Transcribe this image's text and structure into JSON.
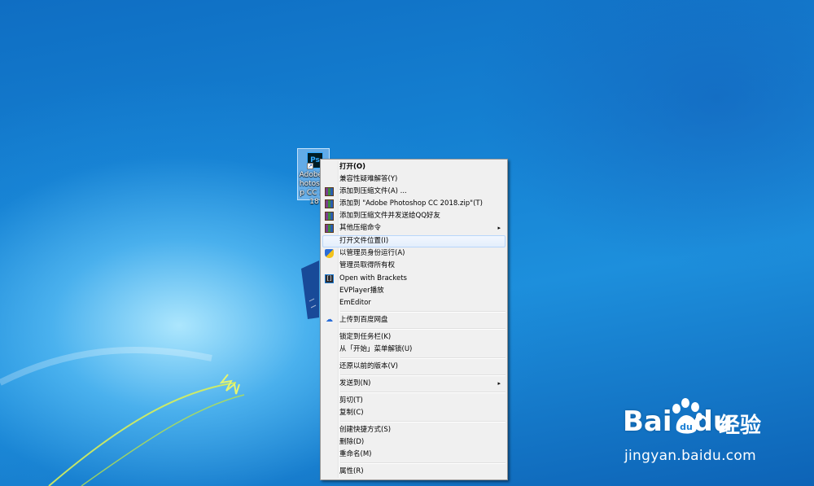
{
  "desktop": {
    "icon": {
      "label": "Adobe Photoshop CC 2018",
      "glyph": "Ps",
      "icon": "photoshop-icon"
    }
  },
  "context_menu": {
    "items": [
      {
        "label": "打开(O)",
        "bold": true
      },
      {
        "label": "兼容性疑难解答(Y)"
      },
      {
        "label": "添加到压缩文件(A) ...",
        "icon": "winrar-icon"
      },
      {
        "label": "添加到 \"Adobe Photoshop CC 2018.zip\"(T)",
        "icon": "winrar-icon"
      },
      {
        "label": "添加到压缩文件并发送给QQ好友",
        "icon": "winrar-icon"
      },
      {
        "label": "其他压缩命令",
        "icon": "winrar-icon",
        "submenu": true
      },
      {
        "label": "打开文件位置(I)",
        "highlighted": true
      },
      {
        "label": "以管理员身份运行(A)",
        "icon": "uac-shield-icon"
      },
      {
        "label": "管理员取得所有权"
      },
      {
        "label": "Open with Brackets",
        "icon": "brackets-icon"
      },
      {
        "label": "EVPlayer播放"
      },
      {
        "label": "EmEditor"
      },
      {
        "label": "上传到百度网盘",
        "icon": "baidu-cloud-icon"
      },
      {
        "label": "锁定到任务栏(K)"
      },
      {
        "label": "从「开始」菜单解锁(U)"
      },
      {
        "label": "还原以前的版本(V)"
      },
      {
        "label": "发送到(N)",
        "submenu": true
      },
      {
        "label": "剪切(T)"
      },
      {
        "label": "复制(C)"
      },
      {
        "label": "创建快捷方式(S)"
      },
      {
        "label": "删除(D)"
      },
      {
        "label": "重命名(M)"
      },
      {
        "label": "属性(R)"
      }
    ],
    "submenu_arrow": "▸"
  },
  "watermark": {
    "brand": "Bai",
    "brand_suffix": "du",
    "chinese": "经验",
    "url": "jingyan.baidu.com"
  },
  "colors": {
    "menu_bg": "#f0f0f0",
    "highlight_border": "#b8d6fb",
    "desktop_blue": "#1273c7"
  }
}
